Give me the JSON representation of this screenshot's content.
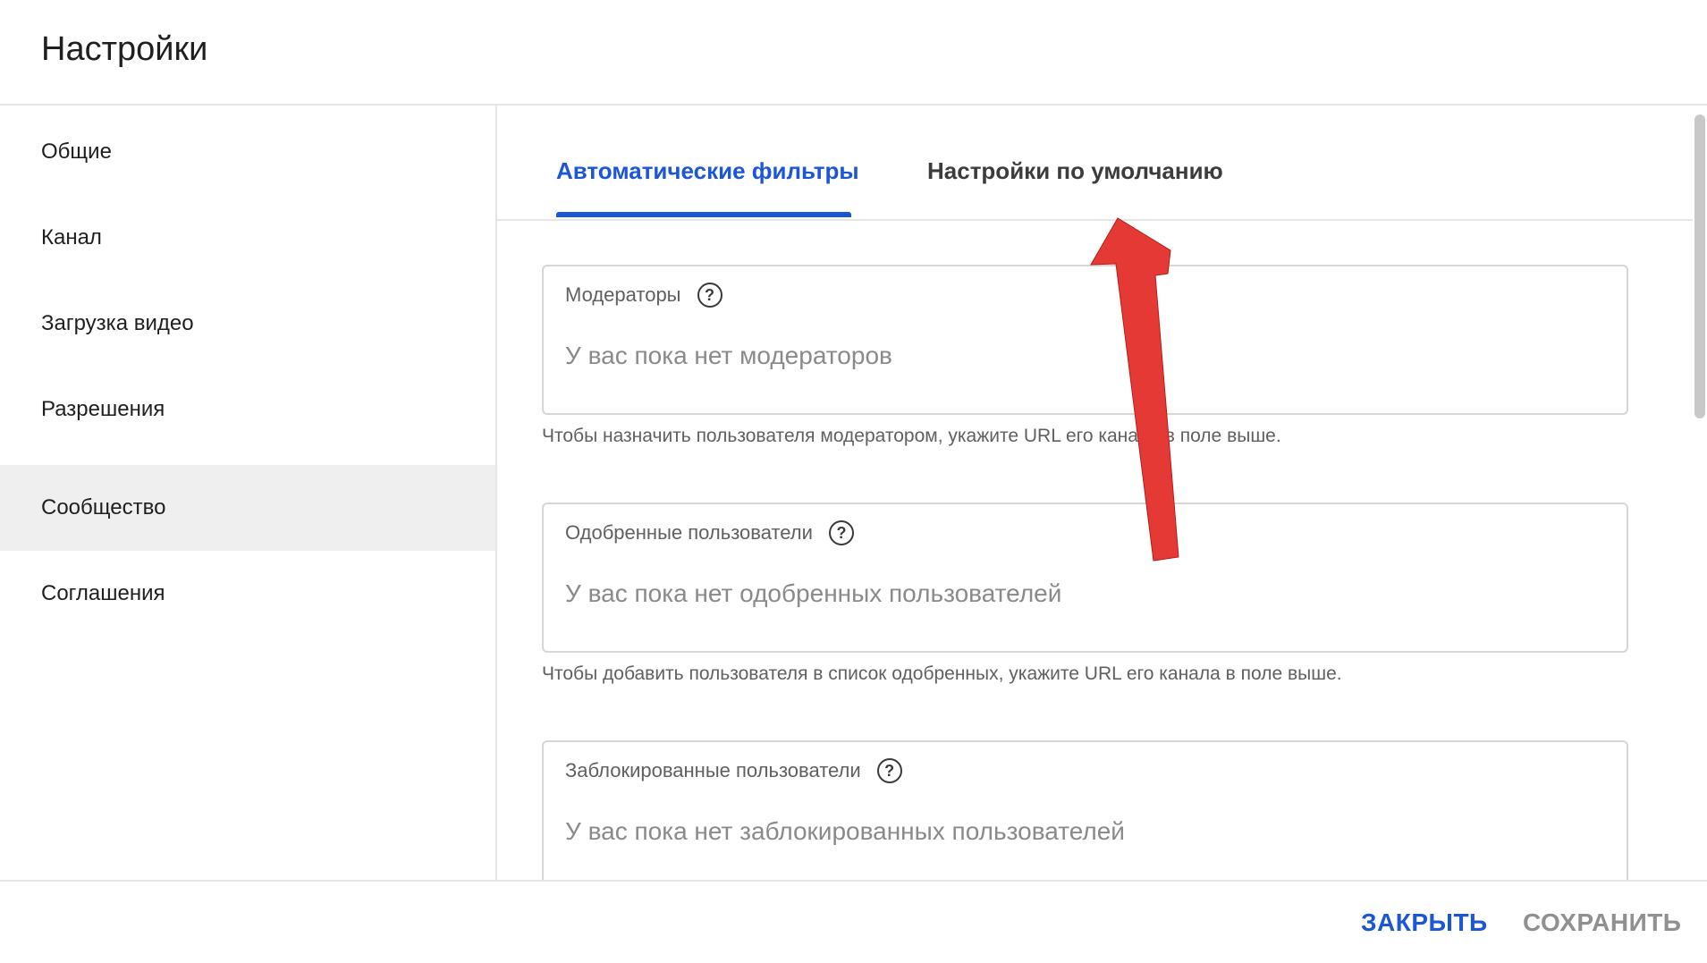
{
  "header": {
    "title": "Настройки"
  },
  "sidebar": {
    "items": [
      {
        "label": "Общие",
        "active": false
      },
      {
        "label": "Канал",
        "active": false
      },
      {
        "label": "Загрузка видео",
        "active": false
      },
      {
        "label": "Разрешения",
        "active": false
      },
      {
        "label": "Сообщество",
        "active": true
      },
      {
        "label": "Соглашения",
        "active": false
      }
    ]
  },
  "tabs": [
    {
      "label": "Автоматические фильтры",
      "active": true
    },
    {
      "label": "Настройки по умолчанию",
      "active": false
    }
  ],
  "fields": [
    {
      "label": "Модераторы",
      "help_icon": "?",
      "placeholder": "У вас пока нет модераторов",
      "hint": "Чтобы назначить пользователя модератором, укажите URL его канала в поле выше."
    },
    {
      "label": "Одобренные пользователи",
      "help_icon": "?",
      "placeholder": "У вас пока нет одобренных пользователей",
      "hint": "Чтобы добавить пользователя в список одобренных, укажите URL его канала в поле выше."
    },
    {
      "label": "Заблокированные пользователи",
      "help_icon": "?",
      "placeholder": "У вас пока нет заблокированных пользователей"
    }
  ],
  "footer": {
    "close_label": "ЗАКРЫТЬ",
    "save_label": "СОХРАНИТЬ"
  },
  "colors": {
    "accent": "#1a56d6",
    "annotation_arrow": "#e53935",
    "active_sidebar_bg": "#efefef"
  },
  "icons": {
    "help": "help-circle-icon",
    "annotation": "red-arrow-annotation"
  }
}
